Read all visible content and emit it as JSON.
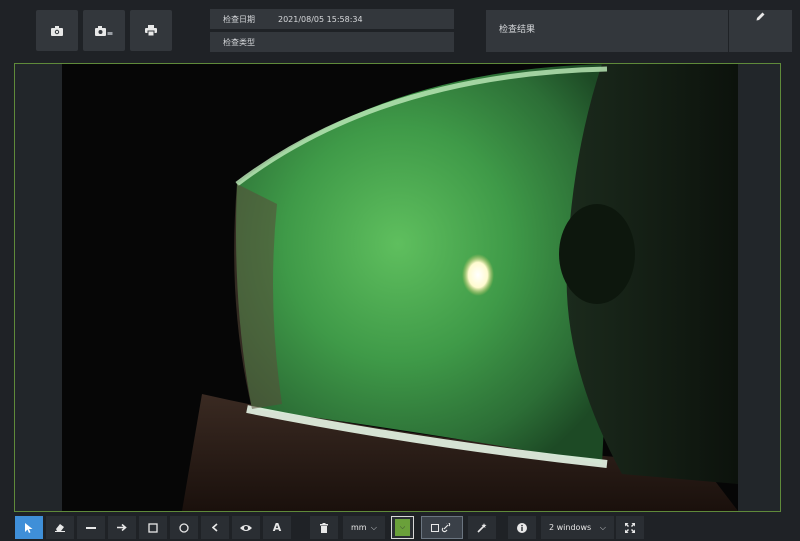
{
  "header": {
    "exam_date_label": "检查日期",
    "exam_date_value": "2021/08/05 15:58:34",
    "exam_type_label": "检查类型",
    "exam_type_value": "",
    "result_label": "检查结果"
  },
  "toolbar": {
    "unit_selected": "mm",
    "windows_selected": "2 windows",
    "text_tool_glyph": "A",
    "color_swatch": "#6aa03a",
    "active_tool_color": "#3f8fd8"
  },
  "icons": {
    "top": [
      "camera-icon",
      "camera-raw-icon",
      "printer-icon",
      "pencil-icon"
    ],
    "tools": [
      "cursor-icon",
      "eraser-icon",
      "line-icon",
      "arrow-icon",
      "rectangle-icon",
      "circle-icon",
      "angle-icon",
      "eye-icon",
      "text-icon",
      "trash-icon",
      "link-icon",
      "magic-wand-icon",
      "info-icon",
      "fullscreen-icon"
    ]
  }
}
